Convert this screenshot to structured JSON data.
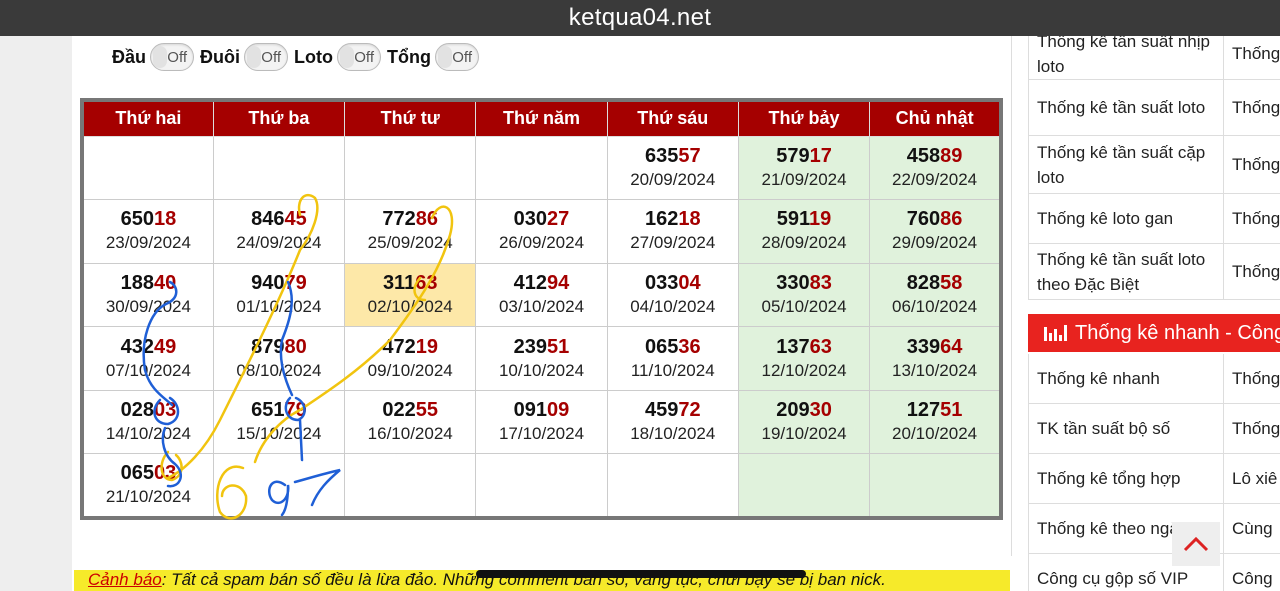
{
  "browser": {
    "url": "ketqua04.net"
  },
  "toggles": [
    {
      "label": "Đầu",
      "state": "Off"
    },
    {
      "label": "Đuôi",
      "state": "Off"
    },
    {
      "label": "Loto",
      "state": "Off"
    },
    {
      "label": "Tổng",
      "state": "Off"
    }
  ],
  "calendar": {
    "headers": [
      "Thứ hai",
      "Thứ ba",
      "Thứ tư",
      "Thứ năm",
      "Thứ sáu",
      "Thứ bảy",
      "Chủ nhật"
    ],
    "rows": [
      [
        null,
        null,
        null,
        null,
        {
          "head": "635",
          "tail": "57",
          "date": "20/09/2024"
        },
        {
          "head": "579",
          "tail": "17",
          "date": "21/09/2024"
        },
        {
          "head": "458",
          "tail": "89",
          "date": "22/09/2024"
        }
      ],
      [
        {
          "head": "650",
          "tail": "18",
          "date": "23/09/2024"
        },
        {
          "head": "846",
          "tail": "45",
          "date": "24/09/2024"
        },
        {
          "head": "772",
          "tail": "86",
          "date": "25/09/2024"
        },
        {
          "head": "030",
          "tail": "27",
          "date": "26/09/2024"
        },
        {
          "head": "162",
          "tail": "18",
          "date": "27/09/2024"
        },
        {
          "head": "591",
          "tail": "19",
          "date": "28/09/2024"
        },
        {
          "head": "760",
          "tail": "86",
          "date": "29/09/2024"
        }
      ],
      [
        {
          "head": "188",
          "tail": "40",
          "date": "30/09/2024"
        },
        {
          "head": "940",
          "tail": "79",
          "date": "01/10/2024"
        },
        {
          "head": "311",
          "tail": "63",
          "date": "02/10/2024",
          "today": true
        },
        {
          "head": "412",
          "tail": "94",
          "date": "03/10/2024"
        },
        {
          "head": "033",
          "tail": "04",
          "date": "04/10/2024"
        },
        {
          "head": "330",
          "tail": "83",
          "date": "05/10/2024"
        },
        {
          "head": "828",
          "tail": "58",
          "date": "06/10/2024"
        }
      ],
      [
        {
          "head": "432",
          "tail": "49",
          "date": "07/10/2024"
        },
        {
          "head": "879",
          "tail": "80",
          "date": "08/10/2024"
        },
        {
          "head": "472",
          "tail": "19",
          "date": "09/10/2024"
        },
        {
          "head": "239",
          "tail": "51",
          "date": "10/10/2024"
        },
        {
          "head": "065",
          "tail": "36",
          "date": "11/10/2024"
        },
        {
          "head": "137",
          "tail": "63",
          "date": "12/10/2024"
        },
        {
          "head": "339",
          "tail": "64",
          "date": "13/10/2024"
        }
      ],
      [
        {
          "head": "028",
          "tail": "03",
          "date": "14/10/2024"
        },
        {
          "head": "651",
          "tail": "79",
          "date": "15/10/2024"
        },
        {
          "head": "022",
          "tail": "55",
          "date": "16/10/2024"
        },
        {
          "head": "091",
          "tail": "09",
          "date": "17/10/2024"
        },
        {
          "head": "459",
          "tail": "72",
          "date": "18/10/2024"
        },
        {
          "head": "209",
          "tail": "30",
          "date": "19/10/2024"
        },
        {
          "head": "127",
          "tail": "51",
          "date": "20/10/2024"
        }
      ],
      [
        {
          "head": "065",
          "tail": "03",
          "date": "21/10/2024"
        },
        null,
        null,
        null,
        null,
        null,
        null
      ]
    ]
  },
  "warning": {
    "label": "Cảnh báo",
    "text": ": Tất cả spam bán số đều là lừa đảo. Những comment bán số, văng tục, chửi bậy sẽ bị ban nick."
  },
  "sidebar": {
    "top_rows": [
      {
        "c1": "Thống kê tần suất nhịp loto",
        "c2": "Thống đặc bi"
      },
      {
        "c1": "Thống kê tần suất loto",
        "c2": "Thống loto"
      },
      {
        "c1": "Thống kê tần suất cặp loto",
        "c2": "Thống dàn cù"
      },
      {
        "c1": "Thống kê loto gan",
        "c2": "Thống"
      },
      {
        "c1": "Thống kê tần suất loto theo Đặc Biệt",
        "c2": "Thống theo lo"
      }
    ],
    "quick_title": "Thống kê nhanh - Công",
    "quick_rows": [
      {
        "c1": "Thống kê nhanh",
        "c2": "Thống"
      },
      {
        "c1": "TK tần suất bộ số",
        "c2": "Thống"
      },
      {
        "c1": "Thống kê tổng hợp",
        "c2": "Lô xiê"
      },
      {
        "c1": "Thống kê theo ngày",
        "c2": "Cùng"
      },
      {
        "c1": "Công cụ gộp số VIP",
        "c2": "Công"
      }
    ]
  },
  "icons": {
    "scroll_top": "chevron-up-icon",
    "stats": "bar-chart-icon"
  },
  "colors": {
    "header_red": "#a50000",
    "weekend_green": "#e0f2dc",
    "today_yellow": "#fde8a8",
    "quick_red": "#e8231f"
  }
}
